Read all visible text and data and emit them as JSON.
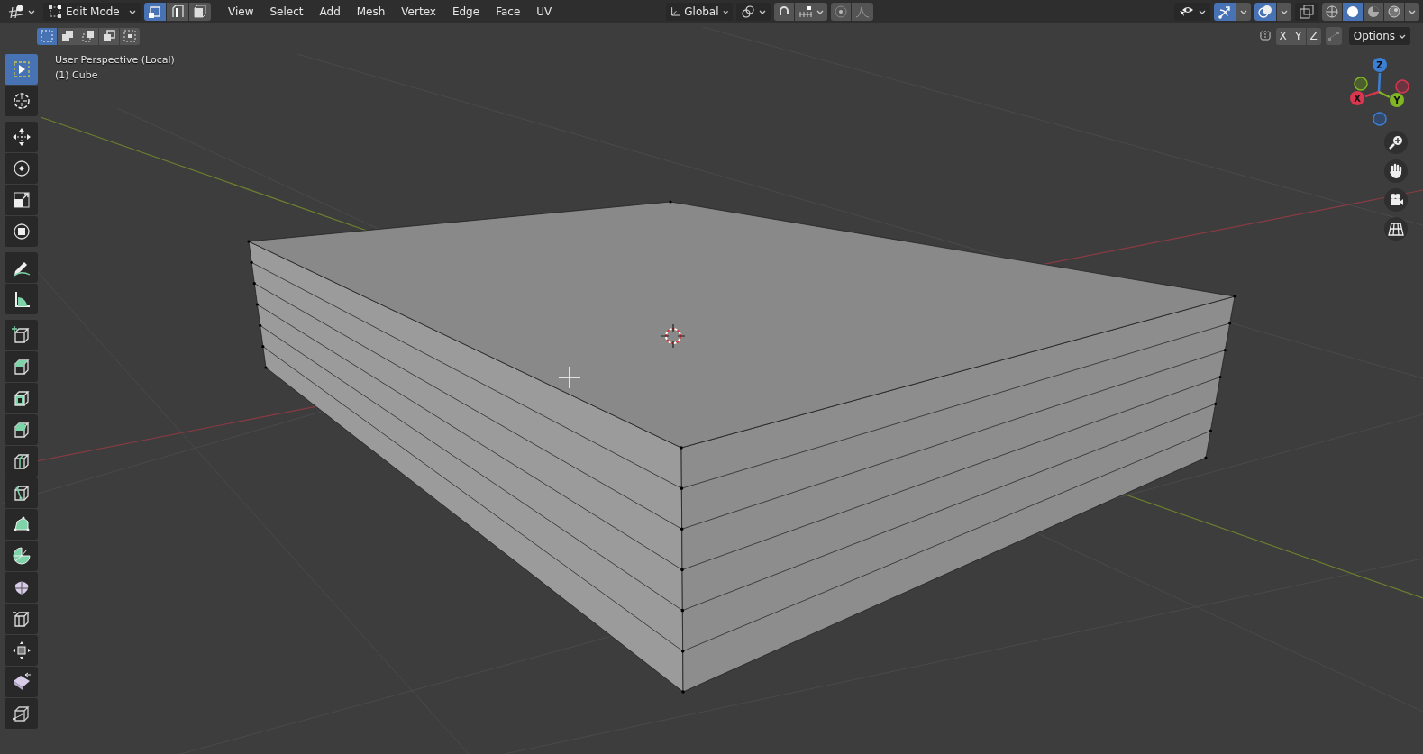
{
  "header": {
    "mode": "Edit Mode",
    "select_modes": [
      {
        "kind": "vertex",
        "selected": true
      },
      {
        "kind": "edge",
        "selected": false
      },
      {
        "kind": "face",
        "selected": false
      }
    ],
    "menus": [
      "View",
      "Select",
      "Add",
      "Mesh",
      "Vertex",
      "Edge",
      "Face",
      "UV"
    ],
    "orientation": "Global",
    "gizmos_on": true,
    "overlays_on": true,
    "shading_modes": [
      {
        "kind": "wireframe",
        "selected": false
      },
      {
        "kind": "solid",
        "selected": true
      },
      {
        "kind": "material",
        "selected": false
      },
      {
        "kind": "rendered",
        "selected": false
      }
    ]
  },
  "tool_settings": {
    "box_modes": [
      {
        "kind": "new",
        "selected": true
      },
      {
        "kind": "extend",
        "selected": false
      },
      {
        "kind": "subtract",
        "selected": false
      },
      {
        "kind": "invert",
        "selected": false
      },
      {
        "kind": "intersect",
        "selected": false
      }
    ],
    "mirror_axes": [
      "X",
      "Y",
      "Z"
    ],
    "options": "Options"
  },
  "viewport": {
    "view_name": "User Perspective (Local)",
    "object_name": "(1) Cube"
  },
  "toolbar": [
    [
      {
        "kind": "select",
        "selected": true
      },
      {
        "kind": "cursor",
        "selected": false
      }
    ],
    [
      {
        "kind": "move",
        "selected": false
      },
      {
        "kind": "rotate",
        "selected": false
      },
      {
        "kind": "scale",
        "selected": false
      },
      {
        "kind": "transform",
        "selected": false
      }
    ],
    [
      {
        "kind": "annotate",
        "selected": false
      },
      {
        "kind": "measure",
        "selected": false
      }
    ],
    [
      {
        "kind": "add_cube",
        "selected": false
      },
      {
        "kind": "extrude",
        "selected": false
      },
      {
        "kind": "inset",
        "selected": false
      },
      {
        "kind": "bevel",
        "selected": false
      },
      {
        "kind": "loop_cut",
        "selected": false
      },
      {
        "kind": "knife",
        "selected": false
      },
      {
        "kind": "poly_build",
        "selected": false
      },
      {
        "kind": "spin",
        "selected": false
      },
      {
        "kind": "smooth",
        "selected": false
      },
      {
        "kind": "edge_slide",
        "selected": false
      },
      {
        "kind": "shrink",
        "selected": false
      },
      {
        "kind": "shear",
        "selected": false
      },
      {
        "kind": "to_sphere",
        "selected": false
      }
    ]
  ],
  "nav_gizmo": {
    "axes": [
      {
        "label": "Z",
        "color": "#3b80d6"
      },
      {
        "label": "X",
        "color": "#d9364f"
      },
      {
        "label": "Y",
        "color": "#80b524"
      }
    ]
  }
}
